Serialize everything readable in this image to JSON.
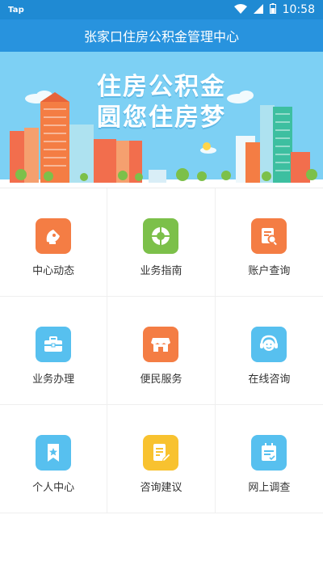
{
  "status": {
    "left": "Tap",
    "time": "10:58"
  },
  "header": {
    "title": "张家口住房公积金管理中心"
  },
  "banner": {
    "line1": "住房公积金",
    "line2": "圆您住房梦"
  },
  "menu": [
    {
      "label": "中心动态",
      "icon": "satellite-dish-icon",
      "color": "#f47d44"
    },
    {
      "label": "业务指南",
      "icon": "compass-icon",
      "color": "#7cc04a"
    },
    {
      "label": "账户查询",
      "icon": "document-search-icon",
      "color": "#f47d44"
    },
    {
      "label": "业务办理",
      "icon": "briefcase-icon",
      "color": "#57c0ef"
    },
    {
      "label": "便民服务",
      "icon": "store-icon",
      "color": "#f47d44"
    },
    {
      "label": "在线咨询",
      "icon": "headset-agent-icon",
      "color": "#57c0ef"
    },
    {
      "label": "个人中心",
      "icon": "bookmark-star-icon",
      "color": "#57c0ef"
    },
    {
      "label": "咨询建议",
      "icon": "document-edit-icon",
      "color": "#f8c22f"
    },
    {
      "label": "网上调查",
      "icon": "calendar-check-icon",
      "color": "#57c0ef"
    }
  ]
}
